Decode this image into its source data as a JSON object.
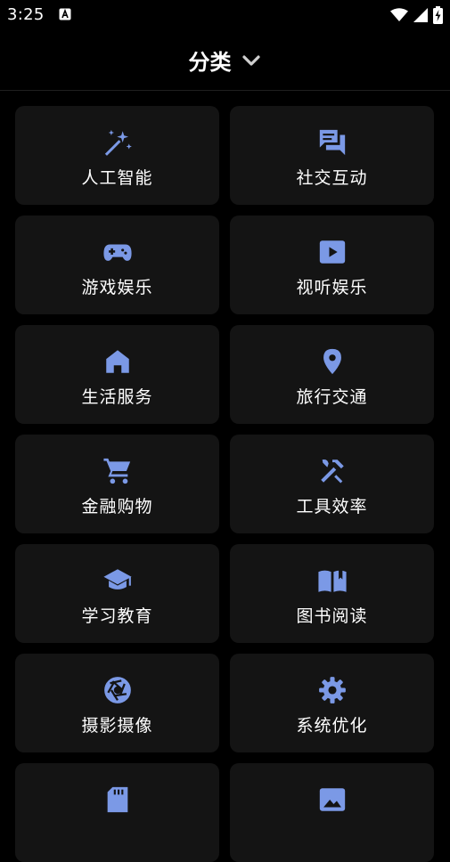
{
  "status": {
    "time": "3:25"
  },
  "header": {
    "title": "分类"
  },
  "colors": {
    "accent": "#7b99e6",
    "tile_bg": "#141414",
    "background": "#000000"
  },
  "categories": [
    {
      "label": "人工智能",
      "icon": "magic-wand-icon"
    },
    {
      "label": "社交互动",
      "icon": "chat-bubbles-icon"
    },
    {
      "label": "游戏娱乐",
      "icon": "gamepad-icon"
    },
    {
      "label": "视听娱乐",
      "icon": "play-video-icon"
    },
    {
      "label": "生活服务",
      "icon": "home-icon"
    },
    {
      "label": "旅行交通",
      "icon": "location-pin-icon"
    },
    {
      "label": "金融购物",
      "icon": "shopping-cart-icon"
    },
    {
      "label": "工具效率",
      "icon": "tools-icon"
    },
    {
      "label": "学习教育",
      "icon": "graduation-cap-icon"
    },
    {
      "label": "图书阅读",
      "icon": "open-book-icon"
    },
    {
      "label": "摄影摄像",
      "icon": "camera-aperture-icon"
    },
    {
      "label": "系统优化",
      "icon": "gear-icon"
    },
    {
      "label": "",
      "icon": "sd-card-icon"
    },
    {
      "label": "",
      "icon": "image-icon"
    }
  ]
}
